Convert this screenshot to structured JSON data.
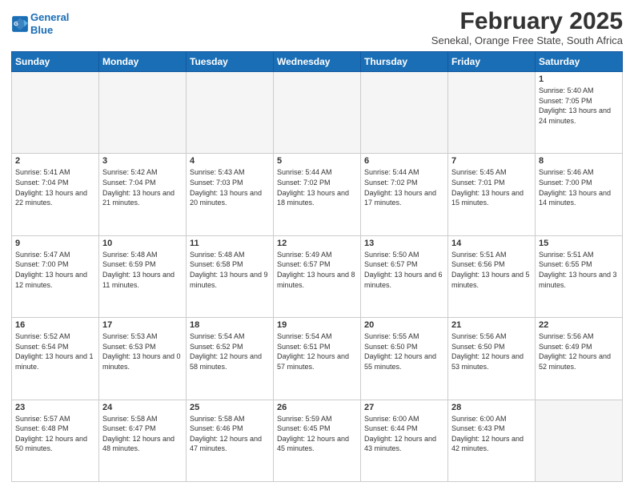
{
  "header": {
    "logo_line1": "General",
    "logo_line2": "Blue",
    "month_title": "February 2025",
    "location": "Senekal, Orange Free State, South Africa"
  },
  "days_of_week": [
    "Sunday",
    "Monday",
    "Tuesday",
    "Wednesday",
    "Thursday",
    "Friday",
    "Saturday"
  ],
  "weeks": [
    [
      {
        "day": "",
        "empty": true
      },
      {
        "day": "",
        "empty": true
      },
      {
        "day": "",
        "empty": true
      },
      {
        "day": "",
        "empty": true
      },
      {
        "day": "",
        "empty": true
      },
      {
        "day": "",
        "empty": true
      },
      {
        "day": "1",
        "sunrise": "5:40 AM",
        "sunset": "7:05 PM",
        "daylight": "13 hours and 24 minutes."
      }
    ],
    [
      {
        "day": "2",
        "sunrise": "5:41 AM",
        "sunset": "7:04 PM",
        "daylight": "13 hours and 22 minutes."
      },
      {
        "day": "3",
        "sunrise": "5:42 AM",
        "sunset": "7:04 PM",
        "daylight": "13 hours and 21 minutes."
      },
      {
        "day": "4",
        "sunrise": "5:43 AM",
        "sunset": "7:03 PM",
        "daylight": "13 hours and 20 minutes."
      },
      {
        "day": "5",
        "sunrise": "5:44 AM",
        "sunset": "7:02 PM",
        "daylight": "13 hours and 18 minutes."
      },
      {
        "day": "6",
        "sunrise": "5:44 AM",
        "sunset": "7:02 PM",
        "daylight": "13 hours and 17 minutes."
      },
      {
        "day": "7",
        "sunrise": "5:45 AM",
        "sunset": "7:01 PM",
        "daylight": "13 hours and 15 minutes."
      },
      {
        "day": "8",
        "sunrise": "5:46 AM",
        "sunset": "7:00 PM",
        "daylight": "13 hours and 14 minutes."
      }
    ],
    [
      {
        "day": "9",
        "sunrise": "5:47 AM",
        "sunset": "7:00 PM",
        "daylight": "13 hours and 12 minutes."
      },
      {
        "day": "10",
        "sunrise": "5:48 AM",
        "sunset": "6:59 PM",
        "daylight": "13 hours and 11 minutes."
      },
      {
        "day": "11",
        "sunrise": "5:48 AM",
        "sunset": "6:58 PM",
        "daylight": "13 hours and 9 minutes."
      },
      {
        "day": "12",
        "sunrise": "5:49 AM",
        "sunset": "6:57 PM",
        "daylight": "13 hours and 8 minutes."
      },
      {
        "day": "13",
        "sunrise": "5:50 AM",
        "sunset": "6:57 PM",
        "daylight": "13 hours and 6 minutes."
      },
      {
        "day": "14",
        "sunrise": "5:51 AM",
        "sunset": "6:56 PM",
        "daylight": "13 hours and 5 minutes."
      },
      {
        "day": "15",
        "sunrise": "5:51 AM",
        "sunset": "6:55 PM",
        "daylight": "13 hours and 3 minutes."
      }
    ],
    [
      {
        "day": "16",
        "sunrise": "5:52 AM",
        "sunset": "6:54 PM",
        "daylight": "13 hours and 1 minute."
      },
      {
        "day": "17",
        "sunrise": "5:53 AM",
        "sunset": "6:53 PM",
        "daylight": "13 hours and 0 minutes."
      },
      {
        "day": "18",
        "sunrise": "5:54 AM",
        "sunset": "6:52 PM",
        "daylight": "12 hours and 58 minutes."
      },
      {
        "day": "19",
        "sunrise": "5:54 AM",
        "sunset": "6:51 PM",
        "daylight": "12 hours and 57 minutes."
      },
      {
        "day": "20",
        "sunrise": "5:55 AM",
        "sunset": "6:50 PM",
        "daylight": "12 hours and 55 minutes."
      },
      {
        "day": "21",
        "sunrise": "5:56 AM",
        "sunset": "6:50 PM",
        "daylight": "12 hours and 53 minutes."
      },
      {
        "day": "22",
        "sunrise": "5:56 AM",
        "sunset": "6:49 PM",
        "daylight": "12 hours and 52 minutes."
      }
    ],
    [
      {
        "day": "23",
        "sunrise": "5:57 AM",
        "sunset": "6:48 PM",
        "daylight": "12 hours and 50 minutes."
      },
      {
        "day": "24",
        "sunrise": "5:58 AM",
        "sunset": "6:47 PM",
        "daylight": "12 hours and 48 minutes."
      },
      {
        "day": "25",
        "sunrise": "5:58 AM",
        "sunset": "6:46 PM",
        "daylight": "12 hours and 47 minutes."
      },
      {
        "day": "26",
        "sunrise": "5:59 AM",
        "sunset": "6:45 PM",
        "daylight": "12 hours and 45 minutes."
      },
      {
        "day": "27",
        "sunrise": "6:00 AM",
        "sunset": "6:44 PM",
        "daylight": "12 hours and 43 minutes."
      },
      {
        "day": "28",
        "sunrise": "6:00 AM",
        "sunset": "6:43 PM",
        "daylight": "12 hours and 42 minutes."
      },
      {
        "day": "",
        "empty": true
      }
    ]
  ]
}
